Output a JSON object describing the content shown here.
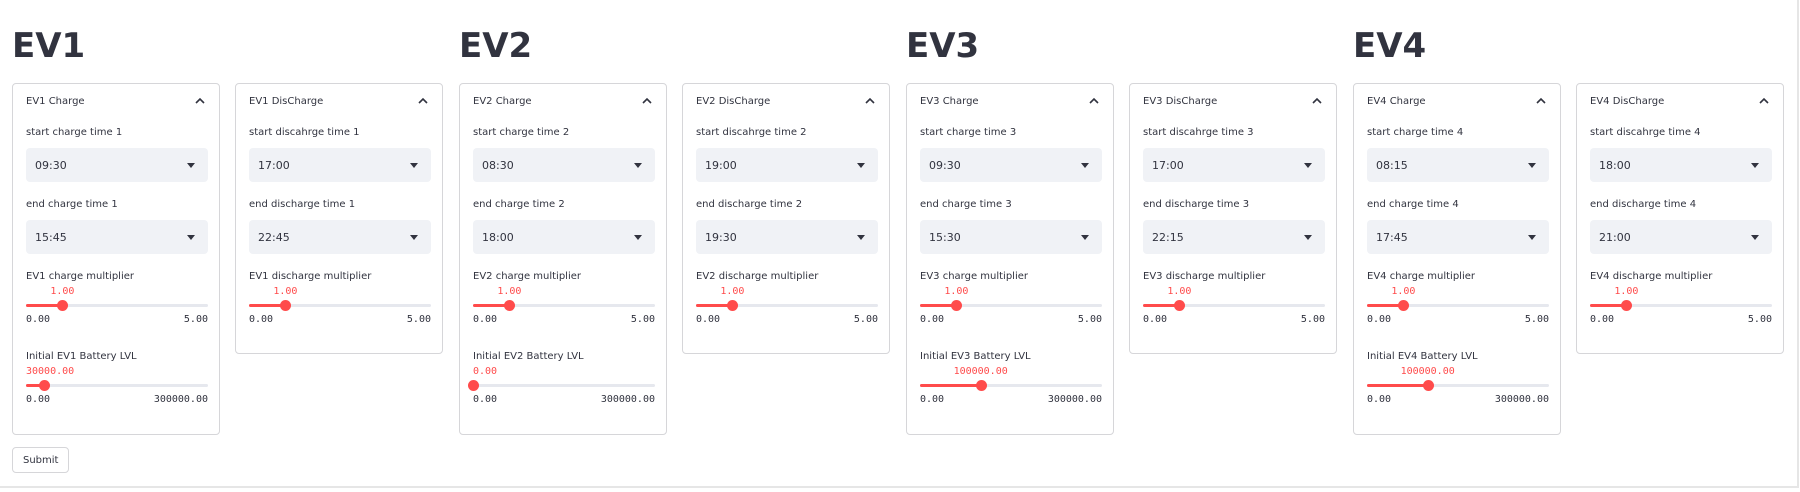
{
  "evs": [
    {
      "title": "EV1",
      "charge": {
        "header": "EV1 Charge",
        "start_label": "start charge time 1",
        "start_value": "09:30",
        "end_label": "end charge time 1",
        "end_value": "15:45",
        "mult_label": "EV1 charge multiplier",
        "mult_value": "1.00",
        "mult_min": "0.00",
        "mult_max": "5.00",
        "mult_frac": 0.2,
        "battery_label": "Initial EV1 Battery LVL",
        "battery_value": "30000.00",
        "battery_min": "0.00",
        "battery_max": "300000.00",
        "battery_frac": 0.1
      },
      "discharge": {
        "header": "EV1 DisCharge",
        "start_label": "start discahrge time 1",
        "start_value": "17:00",
        "end_label": "end discharge time 1",
        "end_value": "22:45",
        "mult_label": "EV1 discharge multiplier",
        "mult_value": "1.00",
        "mult_min": "0.00",
        "mult_max": "5.00",
        "mult_frac": 0.2
      }
    },
    {
      "title": "EV2",
      "charge": {
        "header": "EV2 Charge",
        "start_label": "start charge time 2",
        "start_value": "08:30",
        "end_label": "end charge time 2",
        "end_value": "18:00",
        "mult_label": "EV2 charge multiplier",
        "mult_value": "1.00",
        "mult_min": "0.00",
        "mult_max": "5.00",
        "mult_frac": 0.2,
        "battery_label": "Initial EV2 Battery LVL",
        "battery_value": "0.00",
        "battery_min": "0.00",
        "battery_max": "300000.00",
        "battery_frac": 0.0
      },
      "discharge": {
        "header": "EV2 DisCharge",
        "start_label": "start discahrge time 2",
        "start_value": "19:00",
        "end_label": "end discharge time 2",
        "end_value": "19:30",
        "mult_label": "EV2 discharge multiplier",
        "mult_value": "1.00",
        "mult_min": "0.00",
        "mult_max": "5.00",
        "mult_frac": 0.2
      }
    },
    {
      "title": "EV3",
      "charge": {
        "header": "EV3 Charge",
        "start_label": "start charge time 3",
        "start_value": "09:30",
        "end_label": "end charge time 3",
        "end_value": "15:30",
        "mult_label": "EV3 charge multiplier",
        "mult_value": "1.00",
        "mult_min": "0.00",
        "mult_max": "5.00",
        "mult_frac": 0.2,
        "battery_label": "Initial EV3 Battery LVL",
        "battery_value": "100000.00",
        "battery_min": "0.00",
        "battery_max": "300000.00",
        "battery_frac": 0.3333
      },
      "discharge": {
        "header": "EV3 DisCharge",
        "start_label": "start discahrge time 3",
        "start_value": "17:00",
        "end_label": "end discharge time 3",
        "end_value": "22:15",
        "mult_label": "EV3 discharge multiplier",
        "mult_value": "1.00",
        "mult_min": "0.00",
        "mult_max": "5.00",
        "mult_frac": 0.2
      }
    },
    {
      "title": "EV4",
      "charge": {
        "header": "EV4 Charge",
        "start_label": "start charge time 4",
        "start_value": "08:15",
        "end_label": "end charge time 4",
        "end_value": "17:45",
        "mult_label": "EV4 charge multiplier",
        "mult_value": "1.00",
        "mult_min": "0.00",
        "mult_max": "5.00",
        "mult_frac": 0.2,
        "battery_label": "Initial EV4 Battery LVL",
        "battery_value": "100000.00",
        "battery_min": "0.00",
        "battery_max": "300000.00",
        "battery_frac": 0.3333
      },
      "discharge": {
        "header": "EV4 DisCharge",
        "start_label": "start discahrge time 4",
        "start_value": "18:00",
        "end_label": "end discharge time 4",
        "end_value": "21:00",
        "mult_label": "EV4 discharge multiplier",
        "mult_value": "1.00",
        "mult_min": "0.00",
        "mult_max": "5.00",
        "mult_frac": 0.2
      }
    }
  ],
  "submit_label": "Submit",
  "colors": {
    "accent": "#ff4b4b",
    "select_bg": "#f0f2f6",
    "text": "#31333f",
    "border": "#d6d6d9"
  },
  "icons": {
    "expander": "chevron-up-icon",
    "select": "caret-down-icon"
  }
}
